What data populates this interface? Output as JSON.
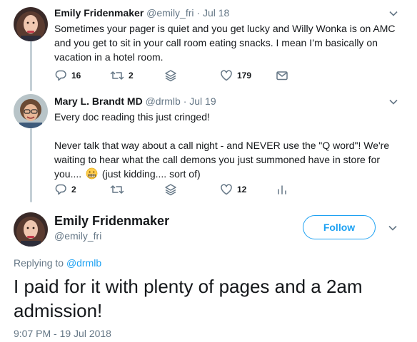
{
  "tweet1": {
    "name": "Emily Fridenmaker",
    "handle": "@emily_fri",
    "separator": "·",
    "date": "Jul 18",
    "lines": [
      "Sometimes your pager is quiet and you get lucky and Willy Wonka is on AMC",
      "and you get to sit in your call room eating snacks. I mean I’m basically on",
      "vacation in a hotel room."
    ],
    "replies": "16",
    "retweets": "2",
    "likes": "179"
  },
  "tweet2": {
    "name": "Mary L. Brandt MD",
    "handle": "@drmlb",
    "separator": "·",
    "date": "Jul 19",
    "line1": "Every doc reading this just cringed!",
    "para_lines": [
      "Never talk that way about a call night  - and NEVER use the \"Q word\"! We're",
      "waiting to hear what the call demons you just summoned have in store for"
    ],
    "last_line_pre": "you....",
    "last_line_post": "(just kidding.... sort of)",
    "replies": "2",
    "likes": "12"
  },
  "main": {
    "name": "Emily Fridenmaker",
    "handle": "@emily_fri",
    "follow_label": "Follow",
    "replying_prefix": "Replying to",
    "replying_to": "@drmlb",
    "text_line1": "I paid for it with plenty of pages and a 2am",
    "text_line2": "admission!",
    "timestamp": "9:07 PM - 19 Jul 2018"
  },
  "colors": {
    "accent": "#1da1f2",
    "secondary_text": "#657786",
    "primary_text": "#14171a",
    "thread_line": "#c4cfd6"
  },
  "icons": [
    "reply-icon",
    "retweet-icon",
    "stack-icon",
    "heart-icon",
    "dm-icon",
    "analytics-icon",
    "chevron-down-icon",
    "grimace-emoji"
  ]
}
